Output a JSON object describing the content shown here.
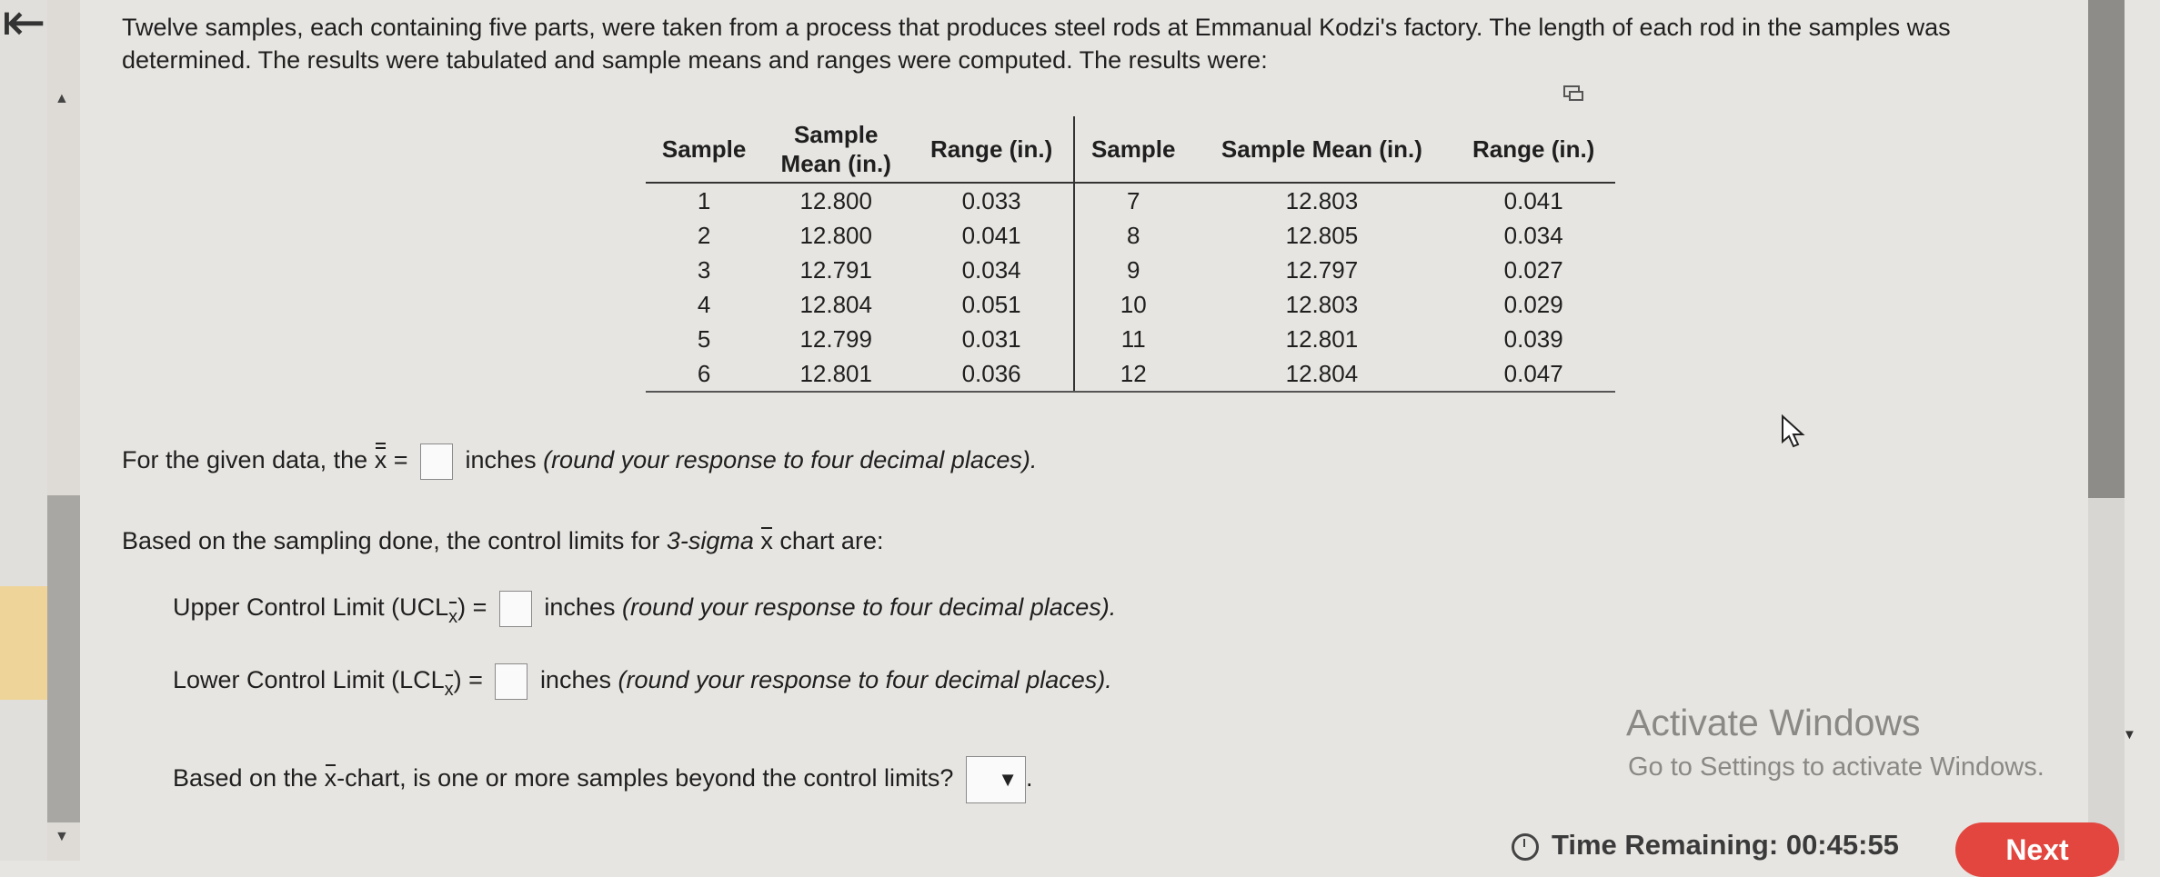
{
  "nav": {
    "back_glyph": "⇤"
  },
  "question": {
    "intro": "Twelve samples, each containing five parts, were taken from a process that produces steel rods at Emmanual Kodzi's factory. The length of each rod in the samples was determined. The results were tabulated and sample means and ranges were computed. The results were:"
  },
  "table": {
    "headers": [
      "Sample",
      "Sample Mean (in.)",
      "Range (in.)",
      "Sample",
      "Sample Mean (in.)",
      "Range (in.)"
    ],
    "rows": [
      [
        "1",
        "12.800",
        "0.033",
        "7",
        "12.803",
        "0.041"
      ],
      [
        "2",
        "12.800",
        "0.041",
        "8",
        "12.805",
        "0.034"
      ],
      [
        "3",
        "12.791",
        "0.034",
        "9",
        "12.797",
        "0.027"
      ],
      [
        "4",
        "12.804",
        "0.051",
        "10",
        "12.803",
        "0.029"
      ],
      [
        "5",
        "12.799",
        "0.031",
        "11",
        "12.801",
        "0.039"
      ],
      [
        "6",
        "12.801",
        "0.036",
        "12",
        "12.804",
        "0.047"
      ]
    ]
  },
  "prompts": {
    "xbarbar_pre": "For the given data, the",
    "xbarbar_sym": "x",
    "eq": "=",
    "xbarbar_post_a": "inches",
    "xbarbar_post_b": "(round your response to four decimal places).",
    "limits_intro_a": "Based on the sampling done, the control limits for",
    "limits_intro_b": "3-sigma",
    "limits_intro_c": "x",
    "limits_intro_d": "chart are:",
    "ucl_label": "Upper Control Limit (UCL",
    "lcl_label": "Lower Control Limit (LCL",
    "sub_x": "x",
    "close_paren": ")",
    "limit_post_a": "inches",
    "limit_post_b": "(round your response to four decimal places).",
    "beyond_a": "Based on the",
    "beyond_x": "x",
    "beyond_b": "-chart, is one or more samples beyond the control limits?",
    "period": "."
  },
  "watermark": {
    "title": "Activate Windows",
    "subtitle": "Go to Settings to activate Windows."
  },
  "footer": {
    "timer_label": "Time Remaining:",
    "timer_value": "00:45:55",
    "next_label": "Next"
  }
}
